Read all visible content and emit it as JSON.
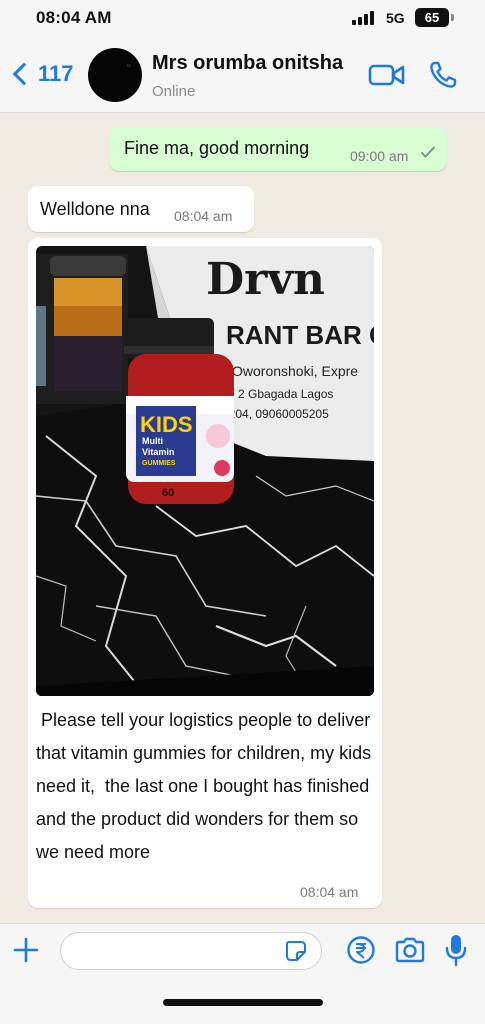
{
  "status_bar": {
    "time": "08:04 AM",
    "network": "5G",
    "battery": "65"
  },
  "header": {
    "back_count": "117",
    "contact_name": "Mrs orumba onitsha",
    "contact_status": "Online",
    "accent_color": "#1f7ae0"
  },
  "messages": [
    {
      "direction": "outgoing",
      "text": "Fine ma, good morning",
      "time": "09:00 am",
      "status": "delivered"
    },
    {
      "direction": "incoming",
      "text": "Welldone nna",
      "time": "08:04 am"
    },
    {
      "direction": "incoming",
      "image": {
        "label_lines": [
          "KIDS",
          "Multi",
          "Vitamin",
          "GUMMIES"
        ],
        "count": "60",
        "bag_text_lines": [
          "Drvn",
          "RANT BAR C",
          "Oworonshoki, Expre",
          "e 2 Gbagada Lagos",
          "5204, 09060005205"
        ]
      },
      "text": " Please tell your logistics people to deliver that vitamin gummies for children, my kids need it,  the last one I bought has finished and the product did wonders for them so we need more",
      "time": "08:04 am"
    }
  ],
  "composer": {
    "placeholder": ""
  },
  "colors": {
    "chat_background": "#efeae2",
    "outgoing_bubble": "#d9fdd3",
    "incoming_bubble": "#ffffff"
  }
}
